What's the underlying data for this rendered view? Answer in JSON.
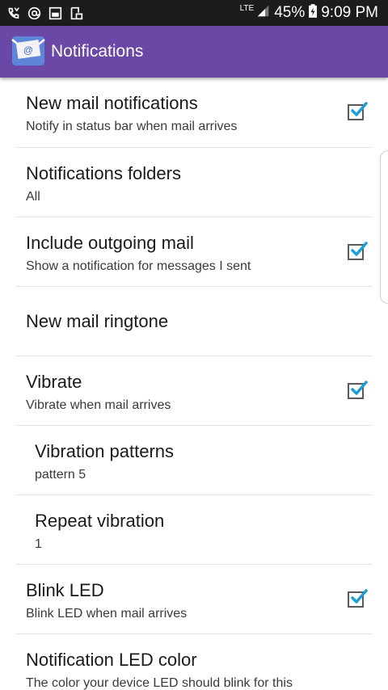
{
  "status_bar": {
    "network": "LTE",
    "battery": "45%",
    "time": "9:09 PM",
    "icons": [
      "missed-call-icon",
      "at-sign-icon",
      "gallery-icon",
      "screenshot-icon",
      "signal-icon",
      "battery-icon"
    ]
  },
  "app_bar": {
    "title": "Notifications",
    "icon": "mail-app-icon",
    "color": "#6b47a6"
  },
  "settings": [
    {
      "title": "New mail notifications",
      "summary": "Notify in status bar when mail arrives",
      "checked": true
    },
    {
      "title": "Notifications folders",
      "summary": "All"
    },
    {
      "title": "Include outgoing mail",
      "summary": "Show a notification for messages I sent",
      "checked": true
    },
    {
      "title": "New mail ringtone"
    },
    {
      "title": "Vibrate",
      "summary": "Vibrate when mail arrives",
      "checked": true
    },
    {
      "title": "Vibration patterns",
      "summary": "pattern 5"
    },
    {
      "title": "Repeat vibration",
      "summary": "1"
    },
    {
      "title": "Blink LED",
      "summary": "Blink LED when mail arrives",
      "checked": true
    },
    {
      "title": "Notification LED color",
      "summary": "The color your device LED should blink for this"
    }
  ],
  "accent_color": "#1e9ed6"
}
